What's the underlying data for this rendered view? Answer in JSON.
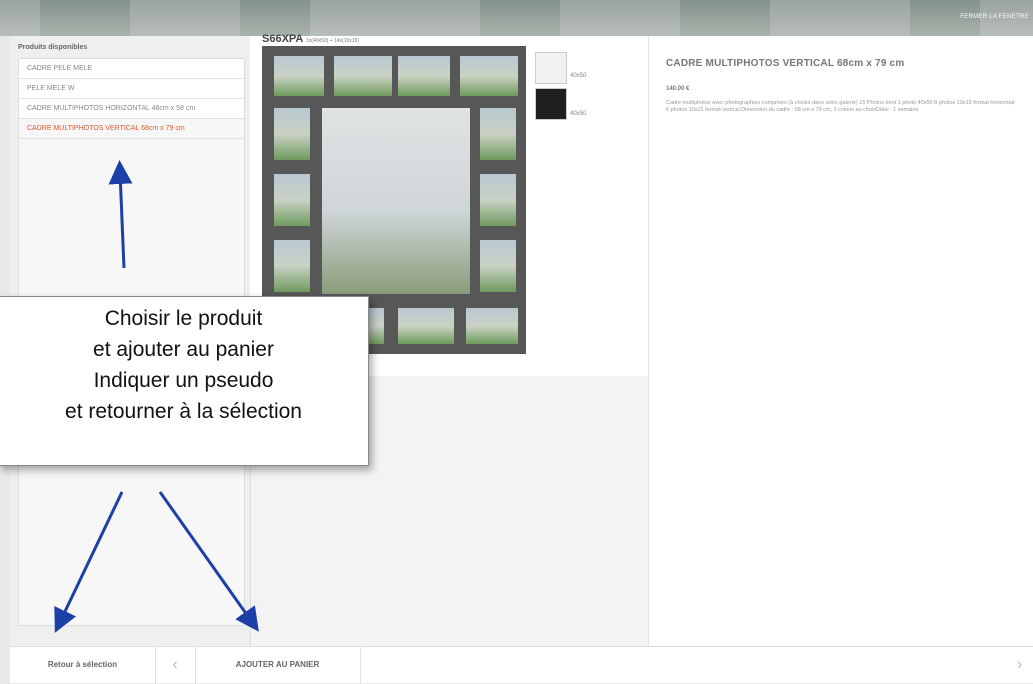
{
  "topbar": {
    "close_label": "FERMER LA FENETRE"
  },
  "sidebar": {
    "title": "Produits disponibles",
    "items": [
      {
        "label": "CADRE PELE MELE",
        "active": false
      },
      {
        "label": "PELE MELE W",
        "active": false
      },
      {
        "label": "CADRE MULTIPHOTOS HORIZONTAL 48cm x 58 cm",
        "active": false
      },
      {
        "label": "CADRE MULTIPHOTOS VERTICAL 68cm x 79 cm",
        "active": true
      }
    ]
  },
  "preview": {
    "reference": "S66XPA",
    "reference_sub": "1x(40x50) + 14x(10x15)",
    "swatches": [
      {
        "color": "#f1f1f1",
        "label": "40x50"
      },
      {
        "color": "#1e1e1e",
        "label": "40x50"
      }
    ]
  },
  "details": {
    "title": "CADRE MULTIPHOTOS VERTICAL 68cm x 79 cm",
    "price": "140.00 €",
    "description": "Cadre multiphotos avec photographies comprises (à choisir dans votre galerie) 15 Photos dont 1 photo 40x50 8 photos 10x15 format horizontal; 6 photos 10x15 format vertical.Dimension du cadre : 68 cm x 79 cm, 2 coloris au choixDélai : 1 semaine"
  },
  "bottombar": {
    "back_label": "Retour à sélection",
    "prev_icon": "‹",
    "add_label": "AJOUTER AU PANIER",
    "next_icon": "›"
  },
  "annotation": {
    "lines": [
      "Choisir le produit",
      "et ajouter au panier",
      "Indiquer un pseudo",
      "et retourner à la sélection"
    ],
    "arrow_color": "#1d3fa8"
  }
}
